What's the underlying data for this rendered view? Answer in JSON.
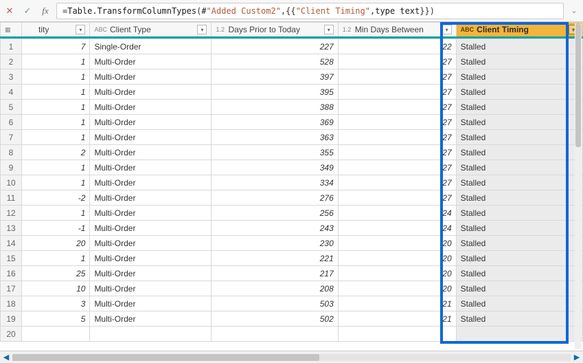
{
  "formula": {
    "tokens": [
      {
        "t": "eq",
        "v": "= "
      },
      {
        "t": "fn",
        "v": "Table.TransformColumnTypes"
      },
      {
        "t": "paren",
        "v": "("
      },
      {
        "t": "fn",
        "v": "#"
      },
      {
        "t": "str",
        "v": "\"Added Custom2\""
      },
      {
        "t": "sep",
        "v": ",{{"
      },
      {
        "t": "str",
        "v": "\"Client Timing\""
      },
      {
        "t": "sep",
        "v": ", "
      },
      {
        "t": "fn",
        "v": "type text"
      },
      {
        "t": "sep",
        "v": "}})"
      }
    ]
  },
  "columns": {
    "tity": {
      "type": "",
      "label": "tity"
    },
    "type": {
      "type": "ABC",
      "label": "Client Type"
    },
    "days": {
      "type": "1.2",
      "label": "Days Prior to Today"
    },
    "min": {
      "type": "1.2",
      "label": "Min Days Between"
    },
    "timing": {
      "type": "ABC",
      "label": "Client Timing"
    }
  },
  "rows": [
    {
      "n": "1",
      "tity": "7",
      "type": "Single-Order",
      "days": "227",
      "min": "22",
      "timing": "Stalled"
    },
    {
      "n": "2",
      "tity": "1",
      "type": "Multi-Order",
      "days": "528",
      "min": "27",
      "timing": "Stalled"
    },
    {
      "n": "3",
      "tity": "1",
      "type": "Multi-Order",
      "days": "397",
      "min": "27",
      "timing": "Stalled"
    },
    {
      "n": "4",
      "tity": "1",
      "type": "Multi-Order",
      "days": "395",
      "min": "27",
      "timing": "Stalled"
    },
    {
      "n": "5",
      "tity": "1",
      "type": "Multi-Order",
      "days": "388",
      "min": "27",
      "timing": "Stalled"
    },
    {
      "n": "6",
      "tity": "1",
      "type": "Multi-Order",
      "days": "369",
      "min": "27",
      "timing": "Stalled"
    },
    {
      "n": "7",
      "tity": "1",
      "type": "Multi-Order",
      "days": "363",
      "min": "27",
      "timing": "Stalled"
    },
    {
      "n": "8",
      "tity": "2",
      "type": "Multi-Order",
      "days": "355",
      "min": "27",
      "timing": "Stalled"
    },
    {
      "n": "9",
      "tity": "1",
      "type": "Multi-Order",
      "days": "349",
      "min": "27",
      "timing": "Stalled"
    },
    {
      "n": "10",
      "tity": "1",
      "type": "Multi-Order",
      "days": "334",
      "min": "27",
      "timing": "Stalled"
    },
    {
      "n": "11",
      "tity": "-2",
      "type": "Multi-Order",
      "days": "276",
      "min": "27",
      "timing": "Stalled"
    },
    {
      "n": "12",
      "tity": "1",
      "type": "Multi-Order",
      "days": "256",
      "min": "24",
      "timing": "Stalled"
    },
    {
      "n": "13",
      "tity": "-1",
      "type": "Multi-Order",
      "days": "243",
      "min": "24",
      "timing": "Stalled"
    },
    {
      "n": "14",
      "tity": "20",
      "type": "Multi-Order",
      "days": "230",
      "min": "20",
      "timing": "Stalled"
    },
    {
      "n": "15",
      "tity": "1",
      "type": "Multi-Order",
      "days": "221",
      "min": "20",
      "timing": "Stalled"
    },
    {
      "n": "16",
      "tity": "25",
      "type": "Multi-Order",
      "days": "217",
      "min": "20",
      "timing": "Stalled"
    },
    {
      "n": "17",
      "tity": "10",
      "type": "Multi-Order",
      "days": "208",
      "min": "20",
      "timing": "Stalled"
    },
    {
      "n": "18",
      "tity": "3",
      "type": "Multi-Order",
      "days": "503",
      "min": "21",
      "timing": "Stalled"
    },
    {
      "n": "19",
      "tity": "5",
      "type": "Multi-Order",
      "days": "502",
      "min": "21",
      "timing": "Stalled"
    }
  ],
  "extra_rownum": "20"
}
